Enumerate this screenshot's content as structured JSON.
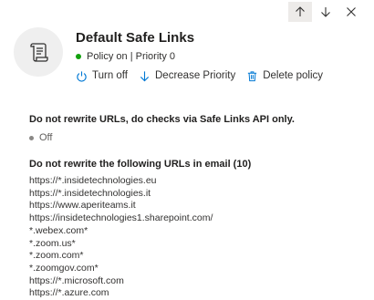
{
  "nav": {
    "up_icon": "arrow-up-icon",
    "down_icon": "arrow-down-icon",
    "close_icon": "close-icon"
  },
  "header": {
    "avatar_icon": "scroll-document-icon",
    "title": "Default Safe Links",
    "status": "Policy on | Priority 0",
    "status_color": "#13a10e"
  },
  "actions": {
    "turn_off": "Turn off",
    "decrease_priority": "Decrease Priority",
    "delete_policy": "Delete policy",
    "accent": "#0078d4"
  },
  "api_section": {
    "title": "Do not rewrite URLs, do checks via Safe Links API only.",
    "value": "Off"
  },
  "urls_section": {
    "title": "Do not rewrite the following URLs in email (10)",
    "urls": [
      "https://*.insidetechnologies.eu",
      "https://*.insidetechnologies.it",
      "https://www.aperiteams.it",
      "https://insidetechnologies1.sharepoint.com/",
      "*.webex.com*",
      "*.zoom.us*",
      "*.zoom.com*",
      "*.zoomgov.com*",
      "https://*.microsoft.com",
      "https://*.azure.com"
    ]
  }
}
